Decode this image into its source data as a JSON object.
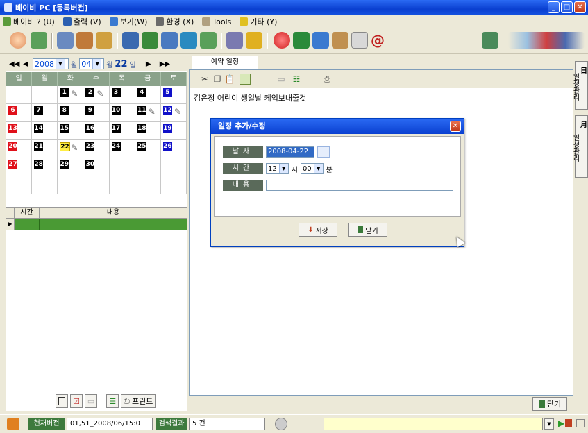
{
  "window": {
    "title": "베이비 PC [등록버전]"
  },
  "menu": [
    {
      "label": "베이비 ? (U)",
      "icon": "baby-icon",
      "color": "#5a9a3a"
    },
    {
      "label": "출력 (V)",
      "icon": "print-icon",
      "color": "#2b5fb0"
    },
    {
      "label": "보기(W)",
      "icon": "magnifier-icon",
      "color": "#3a7ad0"
    },
    {
      "label": "환경 (X)",
      "icon": "settings-icon",
      "color": "#6a6a6a"
    },
    {
      "label": "Tools",
      "icon": "tools-icon",
      "color": "#b0a080"
    },
    {
      "label": "기타 (Y)",
      "icon": "star-icon",
      "color": "#e0c020"
    }
  ],
  "calendar": {
    "year": "2008",
    "month": "04",
    "month_suffix": "월",
    "day": "22",
    "day_suffix": "일",
    "weekdays": [
      "일",
      "월",
      "화",
      "수",
      "목",
      "금",
      "토"
    ],
    "weeks": [
      [
        "",
        "",
        "1",
        "2",
        "3",
        "4",
        "5"
      ],
      [
        "6",
        "7",
        "8",
        "9",
        "10",
        "11",
        "12"
      ],
      [
        "13",
        "14",
        "15",
        "16",
        "17",
        "18",
        "19"
      ],
      [
        "20",
        "21",
        "22",
        "23",
        "24",
        "25",
        "26"
      ],
      [
        "27",
        "28",
        "29",
        "30",
        "",
        "",
        ""
      ],
      [
        "",
        "",
        "",
        "",
        "",
        "",
        ""
      ]
    ],
    "memo_days": [
      "1",
      "2",
      "11",
      "12",
      "22"
    ],
    "today": "22",
    "list_header": {
      "time": "시간",
      "content": "내용"
    }
  },
  "left_footer": {
    "print_label": "프린트"
  },
  "tab": {
    "label": "예약 일정"
  },
  "schedule_text": "김은정 어린이 생일날 케익보내줄것",
  "side_tabs": [
    {
      "hanja": "日",
      "label": "일정관리"
    },
    {
      "hanja": "月",
      "label": "일정관리"
    }
  ],
  "close_label": "닫기",
  "dialog": {
    "title": "일정 추가/수정",
    "date_label": "날자",
    "date_value": "2008-04-22",
    "time_label": "시간",
    "hour": "12",
    "hour_unit": "시",
    "minute": "00",
    "minute_unit": "분",
    "content_label": "내용",
    "content_value": "",
    "save_label": "저장",
    "close_label": "닫기"
  },
  "status": {
    "version_tag": "현재버전",
    "version_value": "01,51_2008/06/15:0",
    "result_tag": "검색결과",
    "result_value": "5 건"
  }
}
